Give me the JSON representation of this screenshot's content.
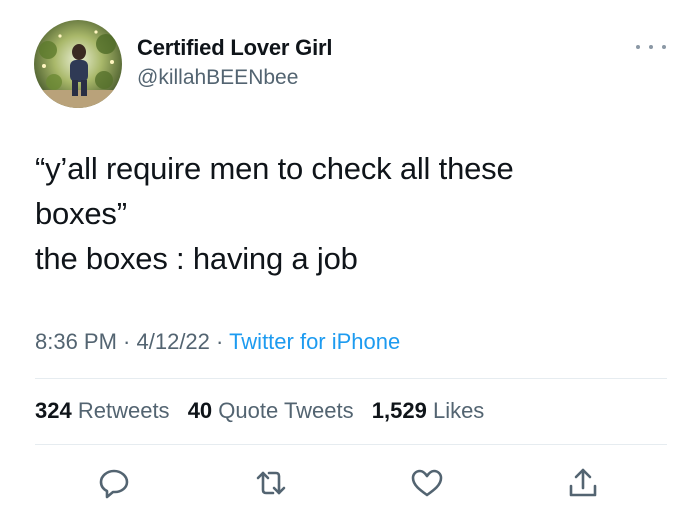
{
  "author": {
    "display_name": "Certified Lover Girl",
    "handle": "@killahBEENbee"
  },
  "tweet": {
    "lines": [
      "“y’all require men to check all these",
      "boxes”",
      "the boxes : having a job"
    ],
    "time": "8:36 PM",
    "date": "4/12/22",
    "source": "Twitter for iPhone",
    "separator": " · "
  },
  "stats": {
    "retweets_count": "324",
    "retweets_label": "Retweets",
    "quotes_count": "40",
    "quotes_label": "Quote Tweets",
    "likes_count": "1,529",
    "likes_label": "Likes"
  },
  "icons": {
    "more": "more-dots-icon",
    "reply": "reply-icon",
    "retweet": "retweet-icon",
    "like": "heart-icon",
    "share": "share-icon"
  },
  "colors": {
    "text": "#0f1419",
    "secondary": "#536471",
    "link": "#1d9bf0",
    "divider": "#e6ecf0"
  }
}
